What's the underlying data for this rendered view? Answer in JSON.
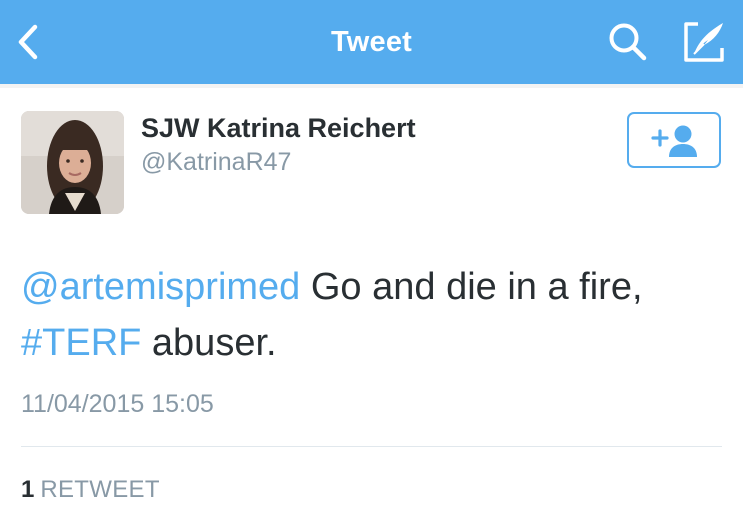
{
  "colors": {
    "brand_blue": "#55acee",
    "text_dark": "#292f33",
    "text_gray": "#8899a6",
    "divider": "#e1e8ed"
  },
  "nav": {
    "title": "Tweet",
    "back_icon": "chevron-left-icon",
    "search_icon": "search-icon",
    "compose_icon": "compose-tweet-icon"
  },
  "tweet": {
    "author": {
      "display_name": "SJW Katrina Reichert",
      "handle": "@KatrinaR47",
      "avatar_icon": "profile-photo"
    },
    "follow_icon": "follow-user-icon",
    "text_parts": {
      "mention": "@artemisprimed",
      "text1": " Go and die in a fire,",
      "hashtag": "#TERF",
      "text2": " abuser."
    },
    "timestamp": "11/04/2015 15:05",
    "stats": {
      "retweet_count": "1",
      "retweet_label": "RETWEET"
    }
  }
}
